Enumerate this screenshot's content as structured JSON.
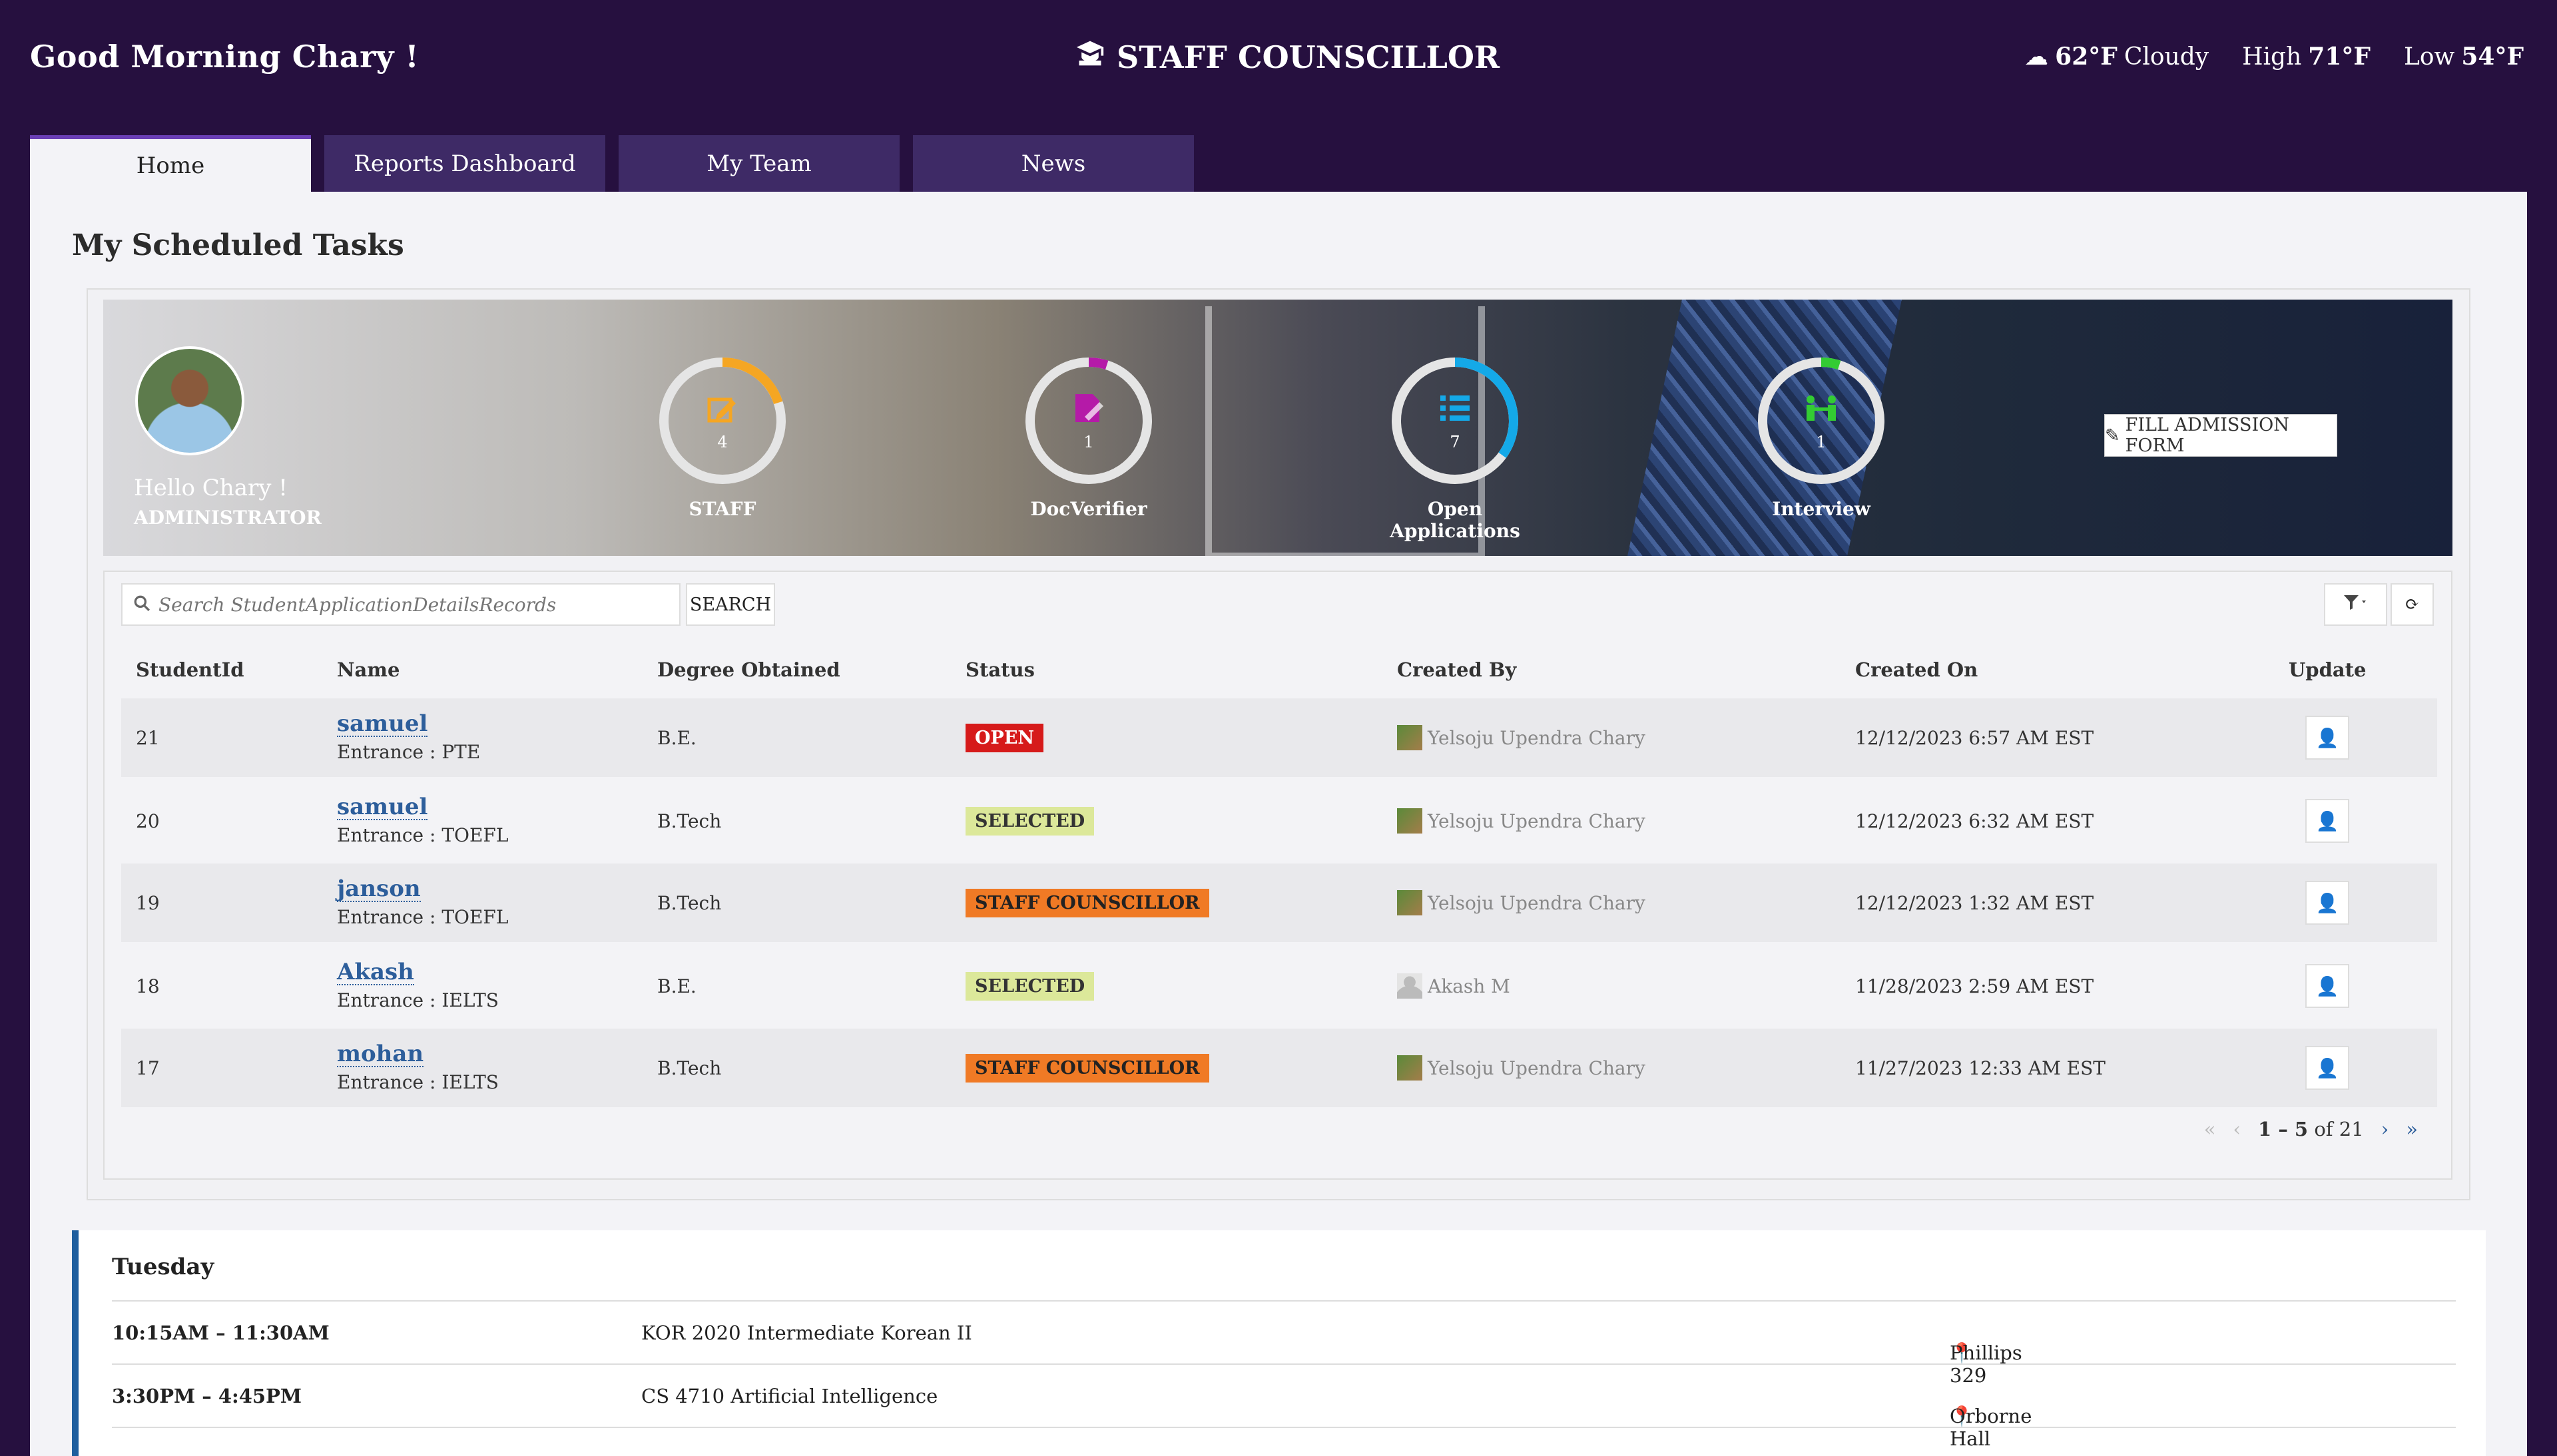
{
  "header": {
    "greeting": "Good Morning Chary !",
    "app_title": "STAFF COUNSCILLOR",
    "weather": {
      "temp": "62°F",
      "condition": "Cloudy",
      "high_label": "High",
      "high": "71°F",
      "low_label": "Low",
      "low": "54°F"
    }
  },
  "tabs": [
    {
      "label": "Home",
      "active": true
    },
    {
      "label": "Reports Dashboard",
      "active": false
    },
    {
      "label": "My Team",
      "active": false
    },
    {
      "label": "News",
      "active": false
    }
  ],
  "main": {
    "section_title": "My Scheduled Tasks",
    "banner": {
      "hello": "Hello Chary !",
      "role": "ADMINISTRATOR",
      "stats": [
        {
          "label": "STAFF",
          "count": "4",
          "color": "#f5a623",
          "icon": "edit-icon",
          "fraction": 0.2
        },
        {
          "label": "DocVerifier",
          "count": "1",
          "color": "#b51aa8",
          "icon": "doc-edit-icon",
          "fraction": 0.05
        },
        {
          "label": "Open Applications",
          "count": "7",
          "color": "#14a9e8",
          "icon": "list-icon",
          "fraction": 0.35
        },
        {
          "label": "Interview",
          "count": "1",
          "color": "#33cc33",
          "icon": "people-icon",
          "fraction": 0.05
        }
      ],
      "fill_button": "FILL ADMISSION FORM"
    },
    "search": {
      "placeholder": "Search StudentApplicationDetailsRecords",
      "button": "SEARCH"
    },
    "columns": [
      "StudentId",
      "Name",
      "Degree Obtained",
      "Status",
      "Created By",
      "Created On",
      "Update"
    ],
    "rows": [
      {
        "id": "21",
        "name": "samuel",
        "entrance": "Entrance : PTE",
        "degree": "B.E.",
        "status": "OPEN",
        "status_type": "open",
        "created_by": "Yelsoju Upendra Chary",
        "created_on": "12/12/2023 6:57 AM EST"
      },
      {
        "id": "20",
        "name": "samuel",
        "entrance": "Entrance : TOEFL",
        "degree": "B.Tech",
        "status": "SELECTED",
        "status_type": "selected",
        "created_by": "Yelsoju Upendra Chary",
        "created_on": "12/12/2023 6:32 AM EST"
      },
      {
        "id": "19",
        "name": "janson",
        "entrance": "Entrance : TOEFL",
        "degree": "B.Tech",
        "status": "STAFF COUNSCILLOR",
        "status_type": "staff",
        "created_by": "Yelsoju Upendra Chary",
        "created_on": "12/12/2023 1:32 AM EST"
      },
      {
        "id": "18",
        "name": "Akash",
        "entrance": "Entrance : IELTS",
        "degree": "B.E.",
        "status": "SELECTED",
        "status_type": "selected",
        "created_by": "Akash M",
        "created_on": "11/28/2023 2:59 AM EST"
      },
      {
        "id": "17",
        "name": "mohan",
        "entrance": "Entrance : IELTS",
        "degree": "B.Tech",
        "status": "STAFF COUNSCILLOR",
        "status_type": "staff",
        "created_by": "Yelsoju Upendra Chary",
        "created_on": "11/27/2023 12:33 AM EST"
      }
    ],
    "pager": {
      "range": "1 – 5",
      "of_text": "of 21"
    }
  },
  "schedule": {
    "day": "Tuesday",
    "items": [
      {
        "time": "10:15AM – 11:30AM",
        "course": "KOR 2020 Intermediate Korean II",
        "location": "Phillips 329"
      },
      {
        "time": "3:30PM – 4:45PM",
        "course": "CS 4710 Artificial Intelligence",
        "location": "Orborne Hall"
      }
    ]
  }
}
